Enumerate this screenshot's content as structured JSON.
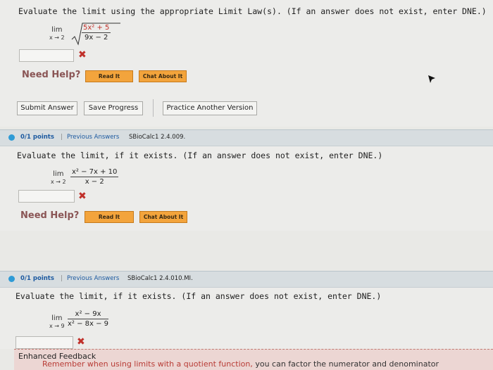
{
  "problem1": {
    "prompt": "Evaluate the limit using the appropriate Limit Law(s). (If an answer does not exist, enter DNE.)",
    "lim": "lim",
    "approach": "x → 2",
    "numerator": "5x² + 5",
    "denominator": "9x − 2",
    "mark": "✖",
    "need_help": "Need Help?",
    "read_it": "Read It",
    "chat_about_it": "Chat About It"
  },
  "actions": {
    "submit_answer": "Submit Answer",
    "save_progress": "Save Progress",
    "practice_another": "Practice Another Version"
  },
  "problem2": {
    "points": "0/1 points",
    "separator": "|",
    "previous_answers": "Previous Answers",
    "code": "SBioCalc1 2.4.009.",
    "prompt": "Evaluate the limit, if it exists. (If an answer does not exist, enter DNE.)",
    "lim": "lim",
    "approach": "x → 2",
    "numerator": "x² − 7x + 10",
    "denominator": "x − 2",
    "mark": "✖",
    "need_help": "Need Help?",
    "read_it": "Read It",
    "chat_about_it": "Chat About It"
  },
  "problem3": {
    "points": "0/1 points",
    "separator": "|",
    "previous_answers": "Previous Answers",
    "code": "SBioCalc1 2.4.010.MI.",
    "prompt": "Evaluate the limit, if it exists. (If an answer does not exist, enter DNE.)",
    "lim": "lim",
    "approach": "x → 9",
    "numerator": "x² − 9x",
    "denominator": "x² − 8x − 9",
    "mark": "✖",
    "feedback_title": "Enhanced Feedback",
    "feedback_text_red": "Remember when using limits with a quotient function,",
    "feedback_text_dark": "you can factor the numerator and denominator"
  },
  "colors": {
    "accent_blue": "#2e9bd6",
    "error_red": "#c0302a",
    "help_orange": "#f3a43c"
  }
}
